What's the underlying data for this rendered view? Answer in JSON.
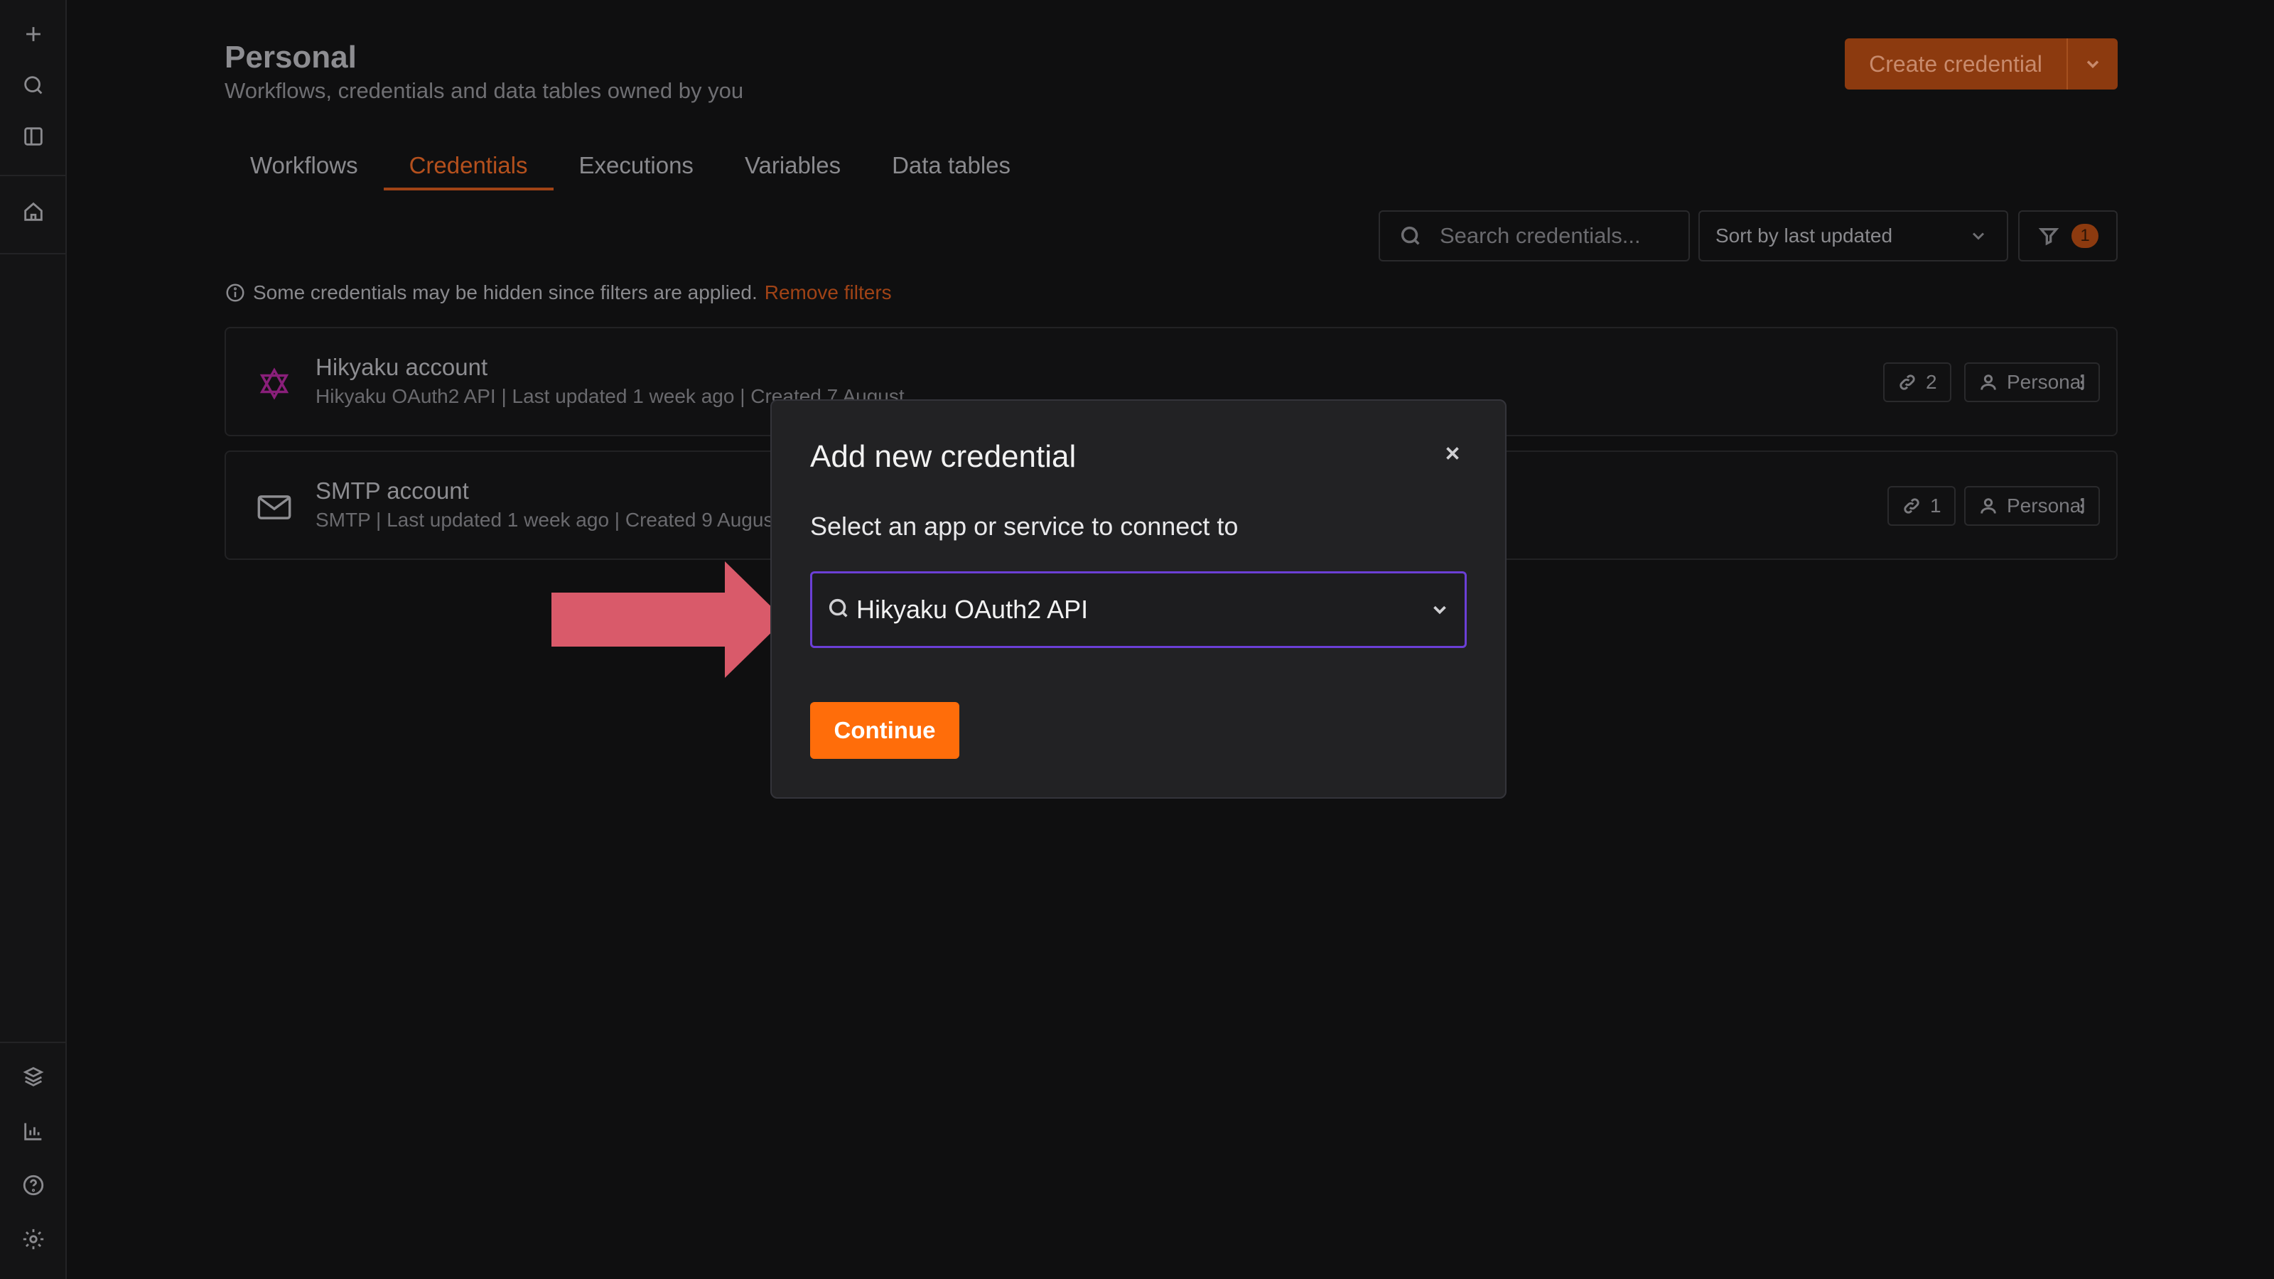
{
  "header": {
    "title": "Personal",
    "subtitle": "Workflows, credentials and data tables owned by you",
    "create_label": "Create credential"
  },
  "tabs": [
    {
      "label": "Workflows"
    },
    {
      "label": "Credentials"
    },
    {
      "label": "Executions"
    },
    {
      "label": "Variables"
    },
    {
      "label": "Data tables"
    }
  ],
  "toolbar": {
    "search_placeholder": "Search credentials...",
    "sort_label": "Sort by last updated",
    "filter_count": "1"
  },
  "notice": {
    "text": "Some credentials may be hidden since filters are applied.",
    "link": "Remove filters"
  },
  "credentials": [
    {
      "name": "Hikyaku account",
      "meta": "Hikyaku OAuth2 API | Last updated 1 week ago | Created 7 August",
      "usage": "2",
      "owner": "Personal",
      "icon": "hikyaku-logo-icon"
    },
    {
      "name": "SMTP account",
      "meta": "SMTP | Last updated 1 week ago | Created 9 August",
      "usage": "1",
      "owner": "Personal",
      "icon": "mail-icon"
    }
  ],
  "modal": {
    "title": "Add new credential",
    "subtitle": "Select an app or service to connect to",
    "selected_value": "Hikyaku OAuth2 API",
    "continue_label": "Continue"
  },
  "colors": {
    "accent": "#ff6d0a",
    "focus": "#6b3fd6",
    "arrow": "#d95a6a"
  }
}
